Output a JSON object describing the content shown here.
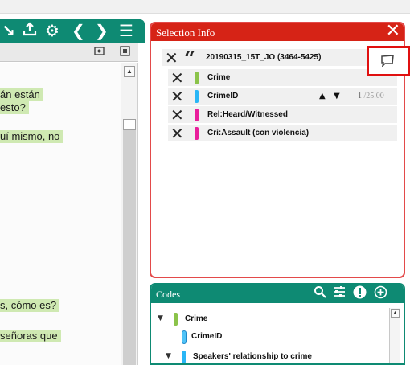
{
  "document_panel": {
    "toolbar_icons": [
      "previous-icon",
      "export-icon",
      "gear-icon",
      "chevron-left-icon",
      "chevron-right-icon",
      "menu-list-icon"
    ],
    "subbar_icons": [
      "image-settings-icon",
      "split-view-icon"
    ],
    "lines": [
      {
        "text": "án están",
        "highlighted": true
      },
      {
        "text": "esto?",
        "highlighted": true
      },
      {
        "text": "uí mismo, no",
        "highlighted": true
      },
      {
        "text": "s, cómo es?",
        "highlighted": true
      },
      {
        "text": "señoras que",
        "highlighted": true
      }
    ]
  },
  "selection_info": {
    "title": "Selection Info",
    "quote": {
      "label": "20190315_15T_JO (3464-5425)"
    },
    "codes": [
      {
        "label": "Crime",
        "color": "#8bc34a"
      },
      {
        "label": "CrimeID",
        "color": "#29b6f6",
        "page_current": "1",
        "page_total": "/25.00"
      },
      {
        "label": "Rel:Heard/Witnessed",
        "color": "#e91e9b"
      },
      {
        "label": "Cri:Assault (con violencia)",
        "color": "#e91e9b"
      }
    ]
  },
  "codes_panel": {
    "title": "Codes",
    "header_icons": [
      "search-icon",
      "filter-icon",
      "info-icon",
      "add-icon"
    ],
    "tree": [
      {
        "label": "Crime",
        "color": "#8bc34a",
        "expanded": true
      },
      {
        "label": "CrimeID",
        "color": "#29b6f6"
      },
      {
        "label": "Speakers' relationship to crime",
        "color": "#29b6f6",
        "expanded": true
      }
    ]
  },
  "colors": {
    "accent_green": "#0e8a73",
    "selection_red": "#d62316",
    "highlight_green": "#cfe9b2"
  }
}
